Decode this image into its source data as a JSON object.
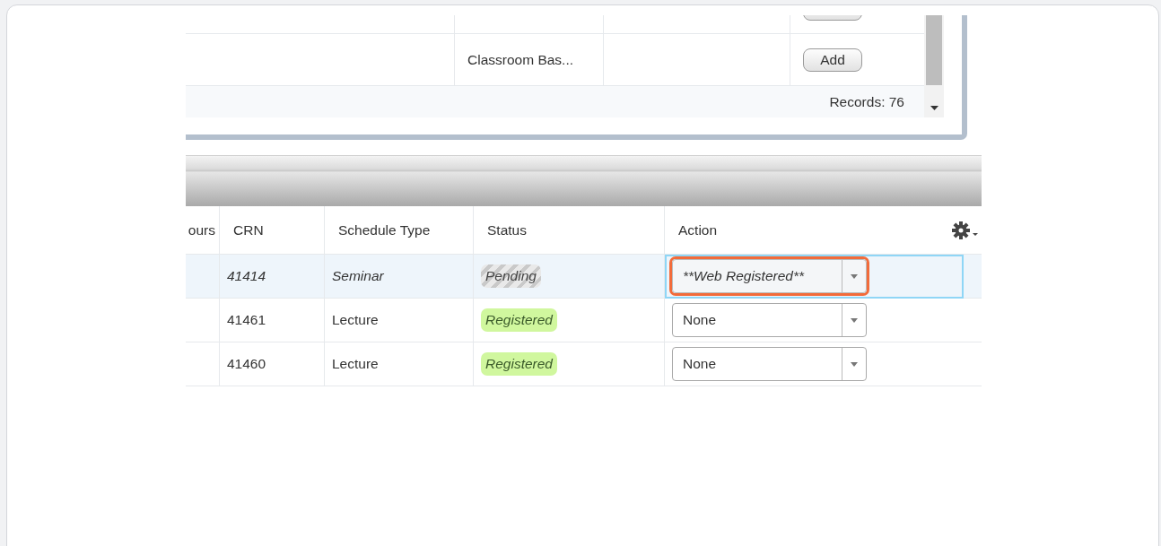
{
  "top_table": {
    "rows": [
      {
        "kind": "partial",
        "column_2": "",
        "button": ""
      },
      {
        "kind": "full",
        "column_2": "Classroom Bas...",
        "button": "Add"
      }
    ],
    "records": "Records: 76"
  },
  "schedule_table": {
    "columns": [
      "ours",
      "CRN",
      "Schedule Type",
      "Status",
      "Action"
    ],
    "rows": [
      {
        "selected": true,
        "crn": "41414",
        "schedule_type": "Seminar",
        "status": {
          "text": "Pending",
          "kind": "pending"
        },
        "action": {
          "value": "**Web Registered**",
          "focused": true
        }
      },
      {
        "selected": false,
        "crn": "41461",
        "schedule_type": "Lecture",
        "status": {
          "text": "Registered",
          "kind": "registered"
        },
        "action": {
          "value": "None",
          "focused": false
        }
      },
      {
        "selected": false,
        "crn": "41460",
        "schedule_type": "Lecture",
        "status": {
          "text": "Registered",
          "kind": "registered"
        },
        "action": {
          "value": "None",
          "focused": false
        }
      }
    ]
  }
}
